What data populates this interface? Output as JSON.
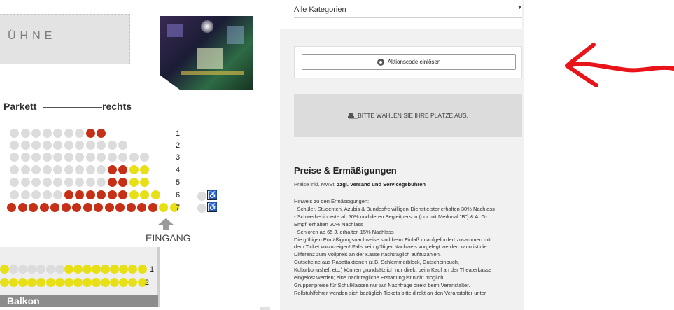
{
  "seat_map": {
    "stage_label": "ÜHNE",
    "section_parkett": "Parkett",
    "section_parkett_side": "rechts",
    "entrance_label": "EINGANG",
    "balcony_label": "Balkon",
    "legend": {
      "free": "#dcdcdc",
      "taken": "#c63016",
      "available": "#e8e016"
    },
    "parkett_rows": [
      {
        "row": "1",
        "seats": [
          "free",
          "free",
          "free",
          "free",
          "free",
          "free",
          "free",
          "taken",
          "taken"
        ]
      },
      {
        "row": "2",
        "seats": [
          "free",
          "free",
          "free",
          "free",
          "free",
          "free",
          "free",
          "free",
          "free",
          "free",
          "free"
        ]
      },
      {
        "row": "3",
        "seats": [
          "free",
          "free",
          "free",
          "free",
          "free",
          "free",
          "free",
          "free",
          "free",
          "free",
          "free",
          "free",
          "free"
        ]
      },
      {
        "row": "4",
        "seats": [
          "free",
          "free",
          "free",
          "free",
          "free",
          "free",
          "free",
          "free",
          "free",
          "taken",
          "taken",
          "avail",
          "avail"
        ]
      },
      {
        "row": "5",
        "seats": [
          "free",
          "free",
          "free",
          "free",
          "free",
          "free",
          "free",
          "free",
          "free",
          "taken",
          "taken",
          "avail",
          "avail"
        ]
      },
      {
        "row": "6",
        "seats": [
          "free",
          "free",
          "free",
          "free",
          "free",
          "taken",
          "taken",
          "taken",
          "taken",
          "taken",
          "taken",
          "avail",
          "avail",
          "avail"
        ]
      },
      {
        "row": "7",
        "seats": [
          "taken",
          "taken",
          "taken",
          "taken",
          "taken",
          "taken",
          "taken",
          "taken",
          "taken",
          "taken",
          "taken",
          "taken",
          "taken",
          "taken",
          "avail",
          "avail"
        ]
      }
    ],
    "balcony_rows": [
      {
        "row": "1",
        "seats": [
          "avail",
          "free",
          "free",
          "free",
          "free",
          "free",
          "free",
          "avail",
          "avail",
          "avail",
          "avail",
          "avail",
          "avail",
          "avail",
          "avail",
          "avail"
        ]
      },
      {
        "row": "2",
        "seats": [
          "avail",
          "avail",
          "avail",
          "avail",
          "avail",
          "avail",
          "avail",
          "avail",
          "avail",
          "avail",
          "avail",
          "avail",
          "avail",
          "avail",
          "avail",
          "avail"
        ]
      }
    ],
    "wheelchair_icon": "wheelchair-icon"
  },
  "booking": {
    "category_select": "Alle Kategorien",
    "promo_button": "Aktionscode einlösen",
    "promo_icon": "tag-icon",
    "select_seats_label": "BITTE WÄHLEN SIE IHRE PLÄTZE AUS.",
    "select_seats_icon": "seat-icon",
    "prices_title": "Preise & Ermäßigungen",
    "prices_subtitle_prefix": "Preise inkl. MwSt. ",
    "prices_subtitle_bold": "zzgl. Versand und Servicegebühren",
    "discount_notes": [
      "Hinweis zu den Ermässigungen:",
      "- Schüler, Studenten, Azubis & Bundesfreiwilligen-Dienstleister erhalten 30% Nachlass",
      "- Schwerbehinderte ab 50% und deren Begleitperson (nur mit Merkmal \"B\") & ALG-",
      "Empf. erhalten 20% Nachlass",
      "- Senioren ab 65 J. erhalten 15% Nachlass",
      "Die gültigen Ermäßigungsnachweise sind beim Einlaß unaufgefordert zusammen mit",
      "dem Ticket vorzuzeigen! Falls kein gültiger Nachweis vorgelegt werden kann ist die",
      "Differenz zum Vollpreis an der Kasse nachträglich aufzuzahlen.",
      "Gutscheine aus Rabattaktionen (z.B. Schlemmerblock, Gutscheinbuch,",
      "Kulturbonusheft etc.) können grundsätzlich nur direkt beim Kauf an der Theaterkasse",
      "eingelöst werden; eine nachträgliche Erstattung ist nicht möglich.",
      "Gruppenpreise für Schulklassen nur auf Nachfrage direkt beim Veranstalter.",
      "Rollstuhlfahrer wenden sich bezüglich Tickets bitte direkt an den Veranstalter unter"
    ]
  },
  "annotation": {
    "arrow_color": "#e8141a"
  }
}
